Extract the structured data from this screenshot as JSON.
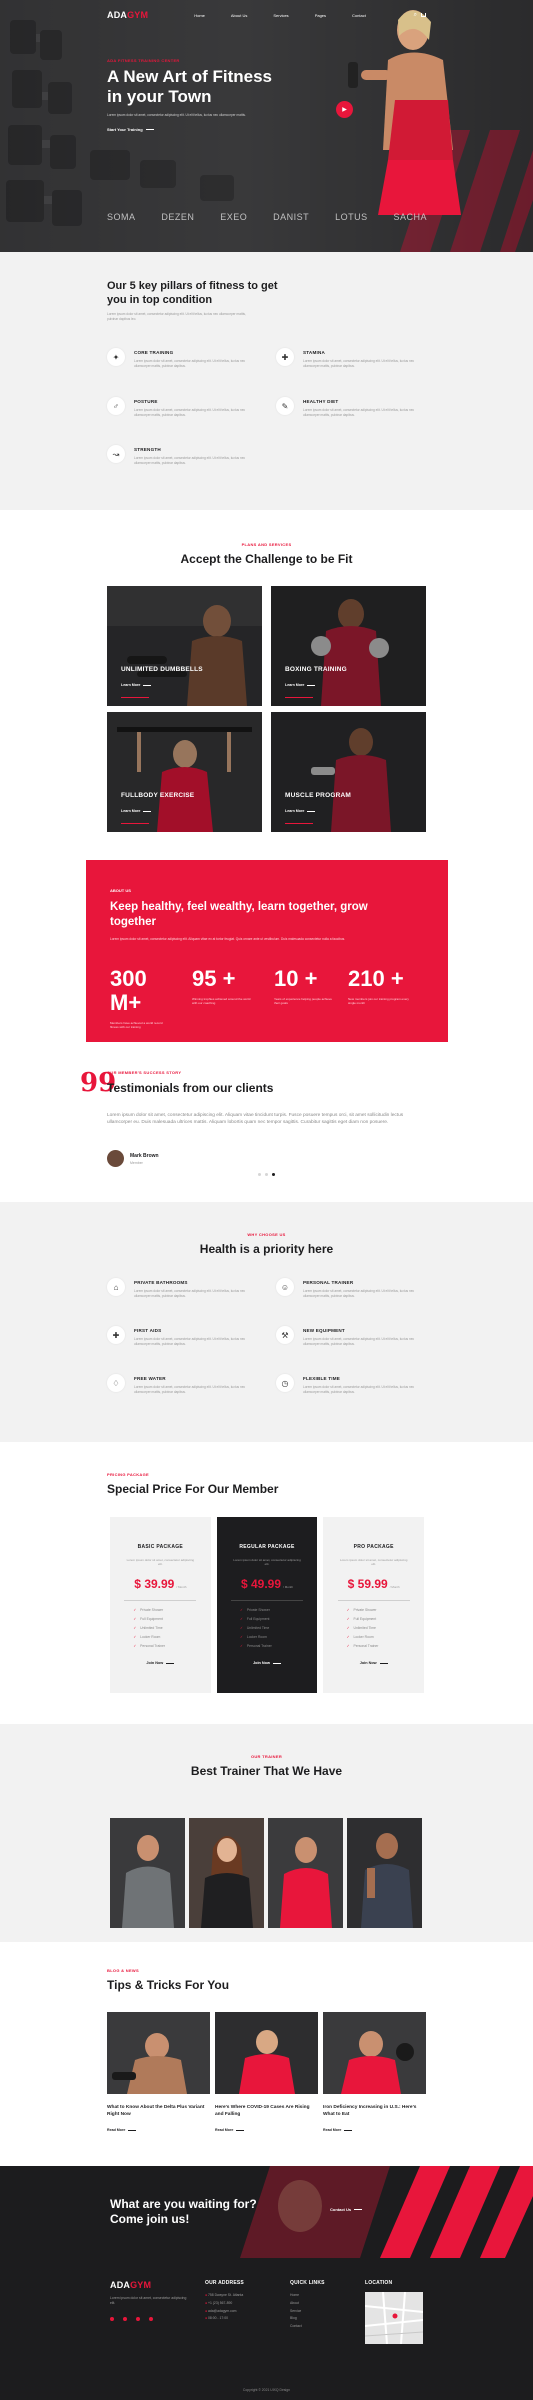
{
  "nav": {
    "logo_a": "ADA",
    "logo_b": "GYM",
    "menu": [
      "Home",
      "About Us",
      "Services",
      "Pages",
      "Contact"
    ]
  },
  "hero": {
    "kicker": "ADA Fitness Training Center",
    "title": "A New Art of Fitness in your Town",
    "desc": "Lorem ipsum dolor sit amet, consectetur adipiscing elit. Ut elit tellus, luctus nec ullamcorper mattis.",
    "cta": "Start Your Training"
  },
  "brands": [
    "SOMA",
    "DEZEN",
    "EXEO",
    "DANIST",
    "LOTUS",
    "SACHA"
  ],
  "pillars": {
    "title": "Our 5 key pillars of fitness to get you in top condition",
    "desc": "Lorem ipsum dolor sit amet, consectetur adipiscing elit. Ut elit tellus, luctus nec ullamcorper mattis, pulvinar dapibus leo.",
    "items": [
      {
        "title": "CORE TRAINING",
        "icon": "core-icon",
        "desc": "Lorem ipsum dolor sit amet, consectetur adipiscing elit. Ut elit tellus, luctus nec ullamcorper mattis, pulvinar dapibus."
      },
      {
        "title": "STAMINA",
        "icon": "stamina-icon",
        "desc": "Lorem ipsum dolor sit amet, consectetur adipiscing elit. Ut elit tellus, luctus nec ullamcorper mattis, pulvinar dapibus."
      },
      {
        "title": "POSTURE",
        "icon": "posture-icon",
        "desc": "Lorem ipsum dolor sit amet, consectetur adipiscing elit. Ut elit tellus, luctus nec ullamcorper mattis, pulvinar dapibus."
      },
      {
        "title": "HEALTHY DIET",
        "icon": "diet-icon",
        "desc": "Lorem ipsum dolor sit amet, consectetur adipiscing elit. Ut elit tellus, luctus nec ullamcorper mattis, pulvinar dapibus."
      },
      {
        "title": "STRENGTH",
        "icon": "strength-icon",
        "desc": "Lorem ipsum dolor sit amet, consectetur adipiscing elit. Ut elit tellus, luctus nec ullamcorper mattis, pulvinar dapibus."
      }
    ]
  },
  "plans": {
    "kicker": "PLANS AND SERVICES",
    "title": "Accept the Challenge to be Fit",
    "cards": [
      {
        "title": "UNLIMITED DUMBBELLS",
        "link": "Learn More"
      },
      {
        "title": "BOXING TRAINING",
        "link": "Learn More"
      },
      {
        "title": "FULLBODY EXERCISE",
        "link": "Learn More"
      },
      {
        "title": "MUSCLE PROGRAM",
        "link": "Learn More"
      }
    ]
  },
  "cta": {
    "kicker": "ABOUT US",
    "title": "Keep healthy, feel wealthy, learn together, grow together",
    "desc": "Lorem ipsum dolor sit amet, consectetur adipiscing elit. Aliquam vitae ex at tortor feugiat. Quis ornare ante ut vestibulum. Duis malesuada consectetur nulla a faucibus.",
    "stats": [
      {
        "num": "300 M+",
        "desc": "Members have achieved a world record fitness with our training"
      },
      {
        "num": "95 +",
        "desc": "Winning trophies achieved around the world with our coaching"
      },
      {
        "num": "10 +",
        "desc": "Years of experience helping people achieve their goals"
      },
      {
        "num": "210 +",
        "desc": "New members join our training program every single month"
      }
    ]
  },
  "testimonials": {
    "kicker": "OUR MEMBER'S SUCCESS STORY",
    "title": "Testimonials from our clients",
    "quote": "Lorem ipsum dolor sit amet, consectetur adipiscing elit. Aliquam vitae tincidunt turpis. Fusce posuere tempus orci, sit amet sollicitudin lectus ullamcorper eu. Duis malesuada ultrices mattis. Aliquam lobortis quam nec tempor sagittis. Curabitur sagittis eget diam non posuere.",
    "name": "Mark Brown",
    "role": "Member"
  },
  "health": {
    "kicker": "WHY CHOOSE US",
    "title": "Health is a priority here",
    "items": [
      {
        "title": "PRIVATE BATHROOMS",
        "icon": "bath-icon",
        "desc": "Lorem ipsum dolor sit amet, consectetur adipiscing elit. Ut elit tellus, luctus nec ullamcorper mattis, pulvinar dapibus."
      },
      {
        "title": "PERSONAL TRAINER",
        "icon": "trainer-icon",
        "desc": "Lorem ipsum dolor sit amet, consectetur adipiscing elit. Ut elit tellus, luctus nec ullamcorper mattis, pulvinar dapibus."
      },
      {
        "title": "FIRST AIDS",
        "icon": "first-aid-icon",
        "desc": "Lorem ipsum dolor sit amet, consectetur adipiscing elit. Ut elit tellus, luctus nec ullamcorper mattis, pulvinar dapibus."
      },
      {
        "title": "NEW EQUIPMENT",
        "icon": "equipment-icon",
        "desc": "Lorem ipsum dolor sit amet, consectetur adipiscing elit. Ut elit tellus, luctus nec ullamcorper mattis, pulvinar dapibus."
      },
      {
        "title": "FREE WATER",
        "icon": "water-icon",
        "desc": "Lorem ipsum dolor sit amet, consectetur adipiscing elit. Ut elit tellus, luctus nec ullamcorper mattis, pulvinar dapibus."
      },
      {
        "title": "FLEXIBLE TIME",
        "icon": "clock-icon",
        "desc": "Lorem ipsum dolor sit amet, consectetur adipiscing elit. Ut elit tellus, luctus nec ullamcorper mattis, pulvinar dapibus."
      }
    ]
  },
  "pricing": {
    "kicker": "PRICING PACKAGE",
    "title": "Special Price For Our Member",
    "cards": [
      {
        "name": "BASIC PACKAGE",
        "desc": "Lorem ipsum dolor sit amet, consectetur adipiscing elit.",
        "currency": "$",
        "price": "39.99",
        "period": "/ Month",
        "cta": "Join Now"
      },
      {
        "name": "REGULAR PACKAGE",
        "desc": "Lorem ipsum dolor sit amet, consectetur adipiscing elit.",
        "currency": "$",
        "price": "49.99",
        "period": "/ Month",
        "cta": "Join Now"
      },
      {
        "name": "PRO PACKAGE",
        "desc": "Lorem ipsum dolor sit amet, consectetur adipiscing elit.",
        "currency": "$",
        "price": "59.99",
        "period": "/ Month",
        "cta": "Join Now"
      }
    ],
    "features": [
      "Private Shower",
      "Full Equipment",
      "Unlimited Time",
      "Locker Room",
      "Personal Trainer"
    ]
  },
  "trainers": {
    "kicker": "OUR TRAINER",
    "title": "Best Trainer That We Have"
  },
  "tips": {
    "kicker": "BLOG & NEWS",
    "title": "Tips & Tricks For You",
    "posts": [
      {
        "title": "What to Know About the Delta Plus Variant Right Now",
        "link": "Read More"
      },
      {
        "title": "Here's Where COVID-19 Cases Are Rising and Falling",
        "link": "Read More"
      },
      {
        "title": "Iron Deficiency Increasing in U.S.: Here's What to Eat",
        "link": "Read More"
      }
    ]
  },
  "banner": {
    "title": "What are you waiting for? Come join us!",
    "cta": "Contact Us"
  },
  "footer": {
    "logo_a": "ADA",
    "logo_b": "GYM",
    "about": "Lorem ipsum dolor sit amet, consectetur adipiscing elit.",
    "address_title": "OUR ADDRESS",
    "address": [
      "758 Dwayne St. Atlanta",
      "+1 (23) 567-890",
      "ada@adagym.com",
      "08:00 - 17:00"
    ],
    "links_title": "QUICK LINKS",
    "links": [
      "Home",
      "About",
      "Service",
      "Blog",
      "Contact"
    ],
    "location_title": "LOCATION",
    "copyright": "Copyright © 2021 UIXQ Design"
  }
}
